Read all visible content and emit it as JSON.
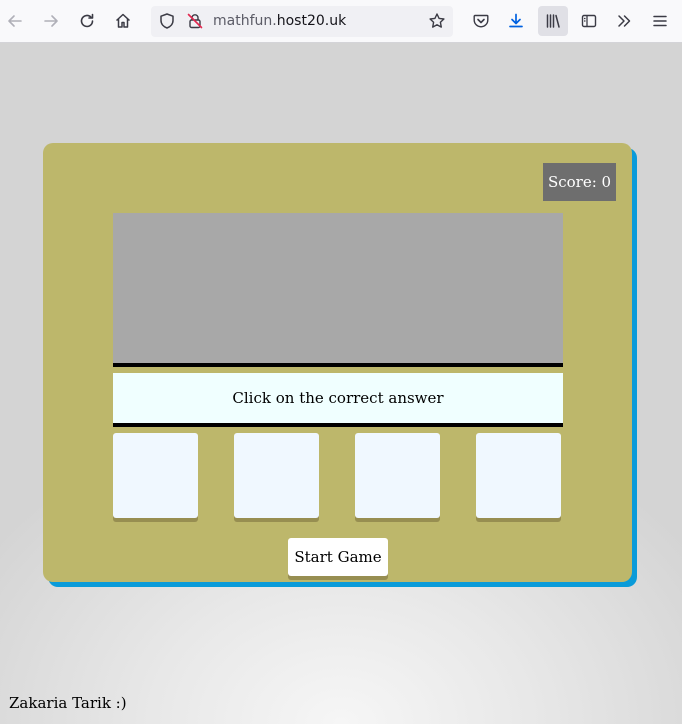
{
  "browser": {
    "url_domain": "mathfun.",
    "url_host": "host20.uk",
    "icons": {
      "back": "arrow-left-icon",
      "forward": "arrow-right-icon",
      "reload": "reload-icon",
      "home": "home-icon",
      "tracking": "shield-icon",
      "permissions": "lock-slash-icon",
      "bookmark": "star-icon",
      "pocket": "pocket-icon",
      "downloads": "download-icon",
      "library": "library-icon",
      "sidebar": "sidebar-icon",
      "overflow": "chevron-double-right-icon",
      "menu": "hamburger-menu-icon"
    },
    "colors": {
      "download_accent": "#0061e0"
    }
  },
  "game": {
    "score_label": "Score: 0",
    "instruction": "Click on the correct answer",
    "question": "",
    "choices": [
      "",
      "",
      "",
      ""
    ],
    "start_label": "Start Game",
    "colors": {
      "card": "#bdb76b",
      "card_shadow": "#0a9bd9",
      "score_bg": "#6e6e6e",
      "question_bg": "#a8a8a8",
      "instruction_bg": "#f0ffff",
      "choice_bg": "#f0f8ff"
    }
  },
  "footer": {
    "text": "Zakaria Tarik :)"
  }
}
